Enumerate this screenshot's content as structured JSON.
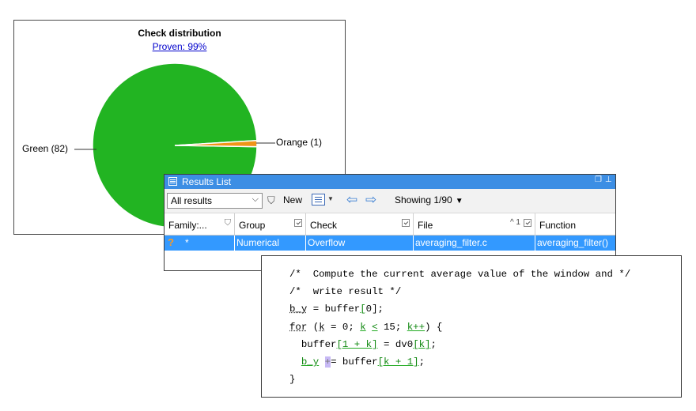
{
  "chart_data": {
    "type": "pie",
    "title": "Check distribution",
    "subtitle": "Proven: 99%",
    "slices": [
      {
        "label": "Green (82)",
        "value": 82,
        "color": "#22b422"
      },
      {
        "label": "Orange (1)",
        "value": 1,
        "color": "#f09518"
      }
    ],
    "legend": "none"
  },
  "results_list": {
    "title": "Results List",
    "window_controls": [
      "restore",
      "pin"
    ],
    "toolbar": {
      "filter_value": "All results",
      "new_label": "New",
      "showing": "Showing 1/90"
    },
    "columns": [
      {
        "label": "Family:...",
        "filter": "funnel"
      },
      {
        "label": "Group",
        "filter": "check"
      },
      {
        "label": "Check",
        "filter": "check"
      },
      {
        "label": "File",
        "sort": "^ 1",
        "filter": "check"
      },
      {
        "label": "Function"
      }
    ],
    "rows": [
      {
        "status_icon": "?",
        "family": "*",
        "group": "Numerical",
        "check": "Overflow",
        "file": "averaging_filter.c",
        "function": "averaging_filter()"
      }
    ],
    "accent_color": "#3399ff"
  },
  "code": {
    "lines": [
      "/*  Compute the current average value of the window and */",
      "/*  write result */",
      "b_y = buffer[0];",
      "for (k = 0; k < 15; k++) {",
      "  buffer[1 + k] = dv0[k];",
      "  b_y += buffer[k + 1];",
      "}"
    ]
  }
}
